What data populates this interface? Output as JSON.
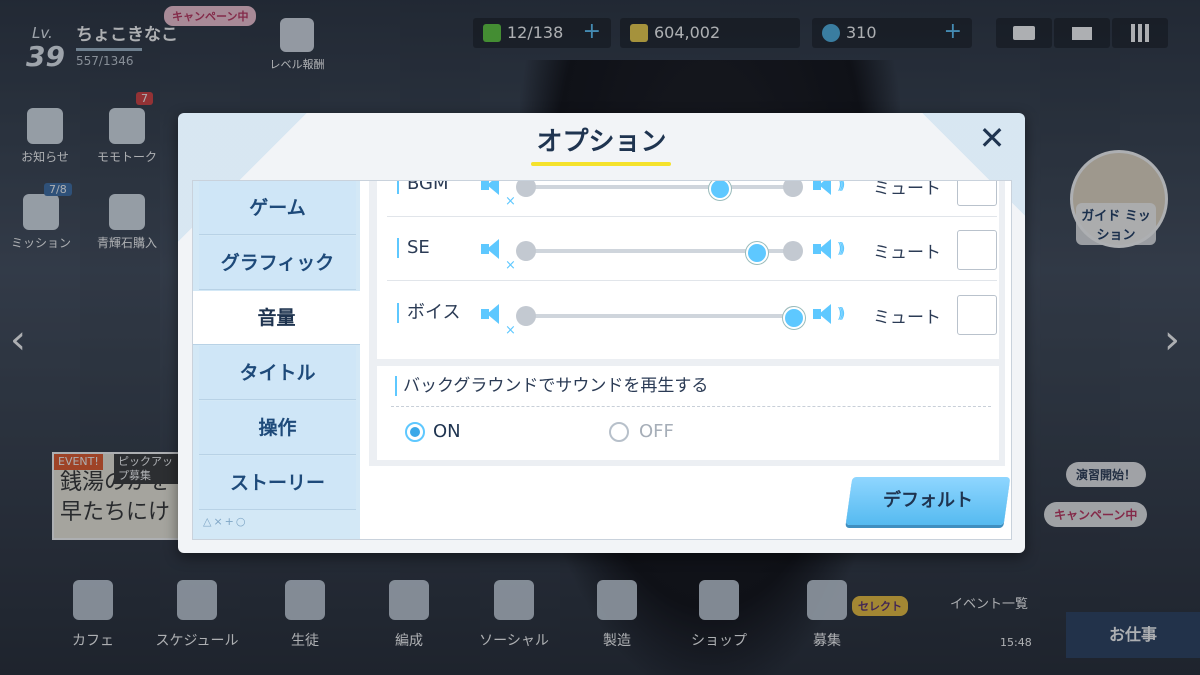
{
  "player": {
    "level_label": "Lv.",
    "level": "39",
    "name": "ちょこきなこ",
    "exp": "557/1346",
    "campaign_tag": "キャンペーン中"
  },
  "top": {
    "level_report": "レベル報酬",
    "stamina": "12/138",
    "credits": "604,002",
    "gems": "310"
  },
  "left_side": {
    "notice": "お知らせ",
    "momotalk": "モモトーク",
    "momotalk_badge": "7",
    "mission": "ミッション",
    "mission_count": "7/8",
    "gem_purchase": "青輝石購入"
  },
  "event_banner": {
    "tag1": "EVENT!",
    "tag2": "ピックアップ募集",
    "text": "銭湯のかを 早たちにけ"
  },
  "right_side": {
    "guide_mission": "ガイド ミッション",
    "drill_start": "演習開始！",
    "campaign": "キャンペーン中",
    "event_list": "イベント一覧"
  },
  "bottom_nav": [
    "カフェ",
    "スケジュール",
    "生徒",
    "編成",
    "ソーシャル",
    "製造",
    "ショップ",
    "募集"
  ],
  "select_badge": "セレクト",
  "work_button": "お仕事",
  "clock": "15:48",
  "modal": {
    "title": "オプション",
    "close": "✕",
    "tabs": [
      "ゲーム",
      "グラフィック",
      "音量",
      "タイトル",
      "操作",
      "ストーリー"
    ],
    "active_tab": "音量",
    "tab_deco": "△×+○",
    "volume_rows": [
      {
        "label": "BGM",
        "value": 0.72,
        "mute_label": "ミュート"
      },
      {
        "label": "SE",
        "value": 0.86,
        "mute_label": "ミュート"
      },
      {
        "label": "ボイス",
        "value": 1.0,
        "mute_label": "ミュート"
      }
    ],
    "bg_sound_title": "バックグラウンドでサウンドを再生する",
    "bg_on": "ON",
    "bg_off": "OFF",
    "bg_selected": "ON",
    "default_button": "デフォルト"
  },
  "colors": {
    "accent": "#5ec8ff",
    "title_underline": "#f5e22c",
    "text_dark": "#1f3450"
  }
}
